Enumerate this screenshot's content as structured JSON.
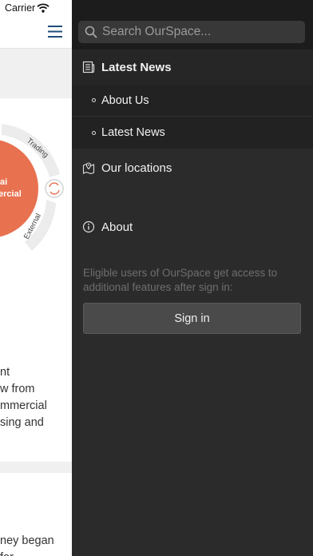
{
  "status_bar": {
    "carrier": "Carrier"
  },
  "background_page": {
    "diagram_labels": {
      "center_line1": "ai",
      "center_line2": "ercial",
      "ring_top": "Trading",
      "ring_bottom": "External"
    },
    "paragraph_lines": [
      "nt",
      "w from",
      "mmercial",
      "sing and"
    ],
    "paragraph2_lines": [
      "ney began",
      "for"
    ]
  },
  "drawer": {
    "search": {
      "placeholder": "Search OurSpace..."
    },
    "menu": {
      "latest_news": {
        "label": "Latest News",
        "icon": "news-icon"
      },
      "sub_items": [
        {
          "label": "About Us"
        },
        {
          "label": "Latest News"
        }
      ],
      "our_locations": {
        "label": "Our locations",
        "icon": "location-map-icon"
      },
      "about": {
        "label": "About",
        "icon": "info-icon"
      }
    },
    "signin": {
      "note": "Eligible users of OurSpace get access to additional features after sign in:",
      "button_label": "Sign in"
    }
  },
  "colors": {
    "drawer_bg": "#2b2b2b",
    "accent_orange": "#e8714f",
    "button_bg": "#4a4a4a"
  }
}
